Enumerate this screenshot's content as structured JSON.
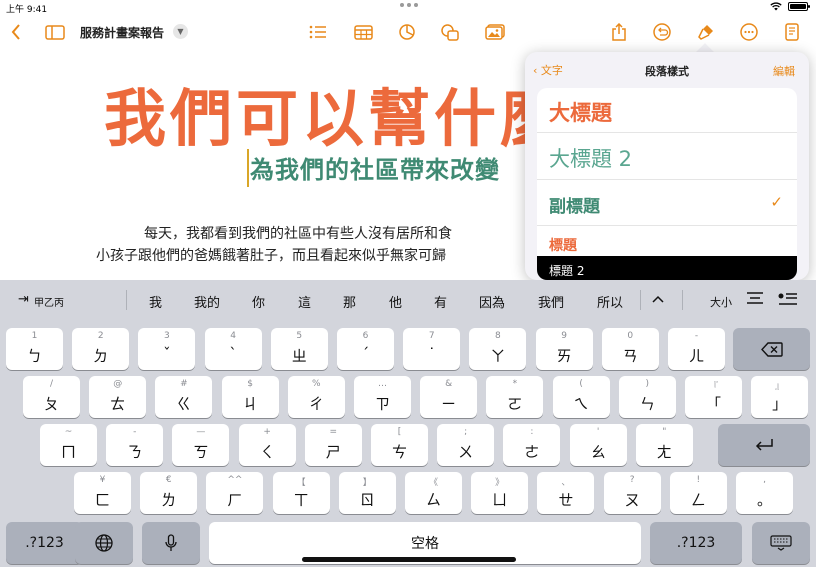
{
  "status_bar": {
    "time": "上午 9:41",
    "battery": "100%"
  },
  "toolbar": {
    "doc_title": "服務計畫案報告",
    "icons": [
      "chevron-left-icon",
      "sidebar-icon",
      "list-icon",
      "table-icon",
      "chart-icon",
      "shapes-icon",
      "media-icon",
      "share-icon",
      "undo-icon",
      "format-brush-icon",
      "more-icon",
      "document-icon"
    ]
  },
  "document": {
    "heading": "我們可以幫什麼",
    "subheading": "為我們的社區帶來改變",
    "body": [
      "每天，我都看到我們的社區中有些人沒有居所和食",
      "小孩子跟他們的爸媽餓著肚子，而且看起來似乎無家可歸"
    ]
  },
  "popover": {
    "back_label": "文字",
    "title": "段落樣式",
    "edit_label": "編輯",
    "styles": [
      {
        "label": "大標題",
        "checked": false
      },
      {
        "label": "大標題 2",
        "checked": false
      },
      {
        "label": "副標題",
        "checked": true
      },
      {
        "label": "標題",
        "checked": false
      },
      {
        "label": "標題 2",
        "checked": false
      }
    ],
    "check_glyph": "✓"
  },
  "keyboard": {
    "input_mode": "甲乙丙",
    "candidates": [
      "我",
      "我的",
      "你",
      "這",
      "那",
      "他",
      "有",
      "因為",
      "我們",
      "所以"
    ],
    "font_size_label": "大小",
    "row1": [
      {
        "hint": "1",
        "main": "ㄅ"
      },
      {
        "hint": "2",
        "main": "ㄉ"
      },
      {
        "hint": "3",
        "main": "ˇ"
      },
      {
        "hint": "4",
        "main": "ˋ"
      },
      {
        "hint": "5",
        "main": "ㄓ"
      },
      {
        "hint": "6",
        "main": "ˊ"
      },
      {
        "hint": "7",
        "main": "˙"
      },
      {
        "hint": "8",
        "main": "ㄚ"
      },
      {
        "hint": "9",
        "main": "ㄞ"
      },
      {
        "hint": "0",
        "main": "ㄢ"
      },
      {
        "hint": "-",
        "main": "ㄦ"
      }
    ],
    "row2": [
      {
        "hint": "/",
        "main": "ㄆ"
      },
      {
        "hint": "@",
        "main": "ㄊ"
      },
      {
        "hint": "#",
        "main": "ㄍ"
      },
      {
        "hint": "$",
        "main": "ㄐ"
      },
      {
        "hint": "%",
        "main": "ㄔ"
      },
      {
        "hint": "…",
        "main": "ㄗ"
      },
      {
        "hint": "&",
        "main": "ㄧ"
      },
      {
        "hint": "*",
        "main": "ㄛ"
      },
      {
        "hint": "(",
        "main": "ㄟ"
      },
      {
        "hint": ")",
        "main": "ㄣ"
      },
      {
        "hint": "『",
        "main": "「"
      },
      {
        "hint": "』",
        "main": "」"
      }
    ],
    "row3": [
      {
        "hint": "~",
        "main": "ㄇ"
      },
      {
        "hint": "-",
        "main": "ㄋ"
      },
      {
        "hint": "—",
        "main": "ㄎ"
      },
      {
        "hint": "+",
        "main": "ㄑ"
      },
      {
        "hint": "=",
        "main": "ㄕ"
      },
      {
        "hint": "[",
        "main": "ㄘ"
      },
      {
        "hint": ";",
        "main": "ㄨ"
      },
      {
        "hint": ":",
        "main": "ㄜ"
      },
      {
        "hint": "'",
        "main": "ㄠ"
      },
      {
        "hint": "\"",
        "main": "ㄤ"
      }
    ],
    "row4": [
      {
        "hint": "¥",
        "main": "ㄈ"
      },
      {
        "hint": "€",
        "main": "ㄌ"
      },
      {
        "hint": "^^",
        "main": "ㄏ"
      },
      {
        "hint": "【",
        "main": "ㄒ"
      },
      {
        "hint": "】",
        "main": "ㄖ"
      },
      {
        "hint": "《",
        "main": "ㄙ"
      },
      {
        "hint": "》",
        "main": "ㄩ"
      },
      {
        "hint": "、",
        "main": "ㄝ"
      },
      {
        "hint": "?",
        "main": "ㄡ"
      },
      {
        "hint": "!",
        "main": "ㄥ"
      },
      {
        "hint": ",",
        "main": "。"
      }
    ],
    "numbers_label": ".?123",
    "space_label": "空格"
  }
}
